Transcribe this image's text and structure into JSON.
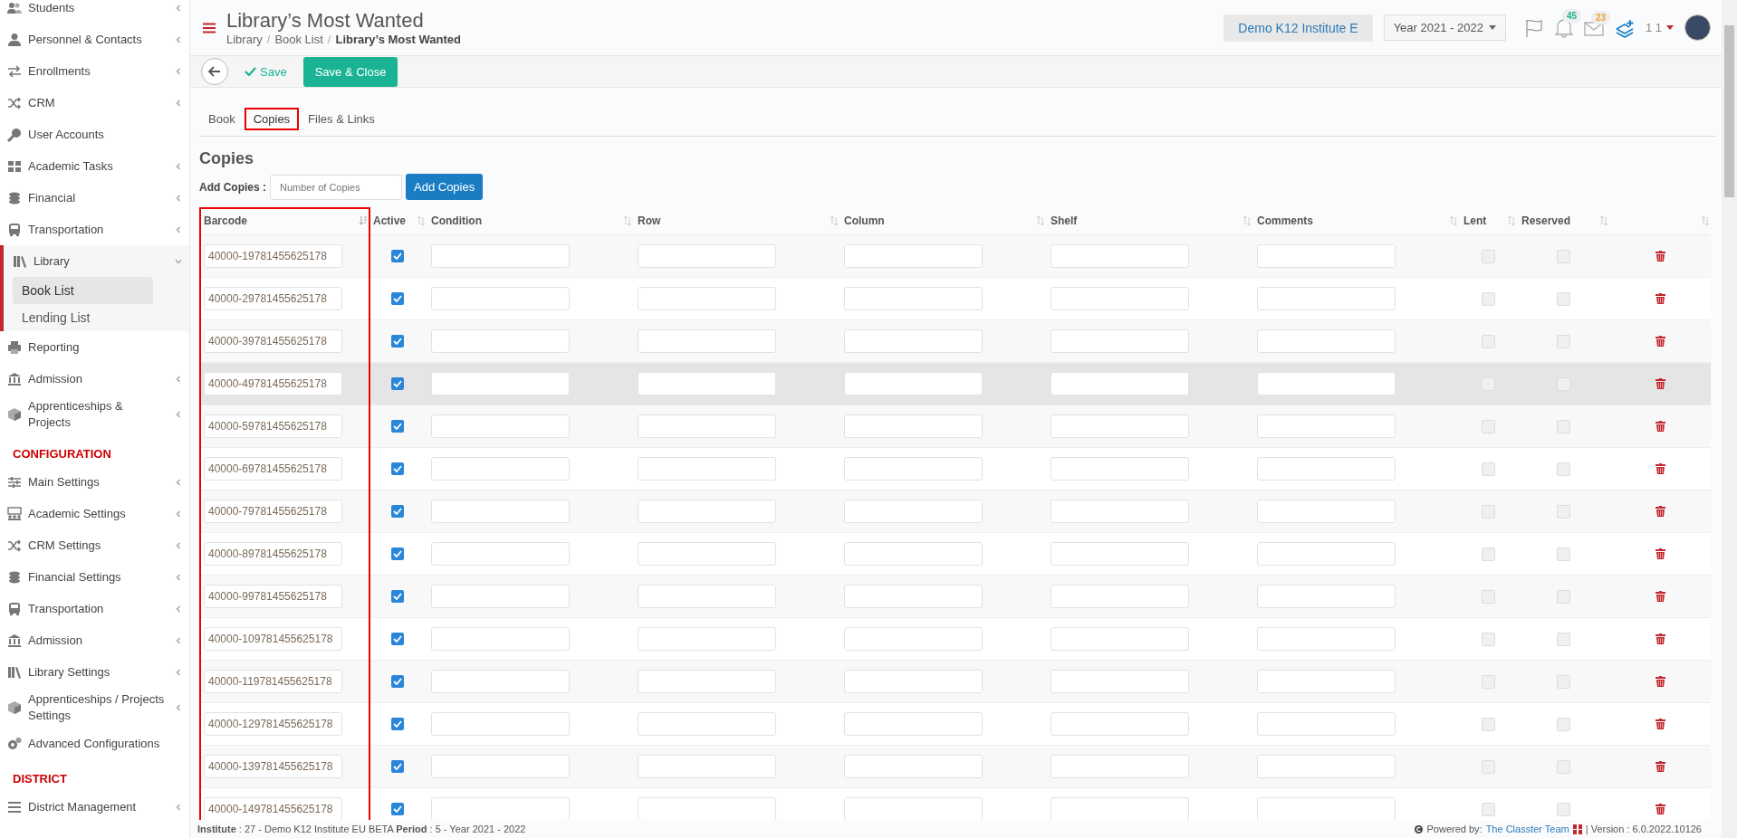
{
  "sidebar": {
    "groups": [
      {
        "items": [
          {
            "label": "Students",
            "has_submenu": true,
            "expanded": false
          },
          {
            "label": "Personnel & Contacts",
            "has_submenu": true,
            "expanded": false
          },
          {
            "label": "Enrollments",
            "has_submenu": true,
            "expanded": false
          },
          {
            "label": "CRM",
            "has_submenu": true,
            "expanded": false
          },
          {
            "label": "User Accounts",
            "has_submenu": false
          },
          {
            "label": "Academic Tasks",
            "has_submenu": true,
            "expanded": false
          },
          {
            "label": "Financial",
            "has_submenu": true,
            "expanded": false
          },
          {
            "label": "Transportation",
            "has_submenu": true,
            "expanded": false
          },
          {
            "label": "Library",
            "has_submenu": true,
            "expanded": true,
            "children": [
              {
                "label": "Book List",
                "selected": true
              },
              {
                "label": "Lending List",
                "selected": false
              }
            ]
          },
          {
            "label": "Reporting",
            "has_submenu": false
          },
          {
            "label": "Admission",
            "has_submenu": true,
            "expanded": false
          },
          {
            "label": "Apprenticeships & Projects",
            "has_submenu": true,
            "expanded": false
          }
        ]
      },
      {
        "heading": "CONFIGURATION",
        "items": [
          {
            "label": "Main Settings",
            "has_submenu": true,
            "expanded": false
          },
          {
            "label": "Academic Settings",
            "has_submenu": true,
            "expanded": false
          },
          {
            "label": "CRM Settings",
            "has_submenu": true,
            "expanded": false
          },
          {
            "label": "Financial Settings",
            "has_submenu": true,
            "expanded": false
          },
          {
            "label": "Transportation",
            "has_submenu": true,
            "expanded": false
          },
          {
            "label": "Admission",
            "has_submenu": true,
            "expanded": false
          },
          {
            "label": "Library Settings",
            "has_submenu": true,
            "expanded": false
          },
          {
            "label": "Apprenticeships / Projects Settings",
            "has_submenu": true,
            "expanded": false
          },
          {
            "label": "Advanced Configurations",
            "has_submenu": false
          }
        ]
      },
      {
        "heading": "DISTRICT",
        "items": [
          {
            "label": "District Management",
            "has_submenu": true,
            "expanded": false
          }
        ]
      }
    ]
  },
  "header": {
    "title": "Library’s Most Wanted",
    "breadcrumbs": [
      "Library",
      "Book List",
      "Library’s Most Wanted"
    ],
    "separator": "/",
    "institute": "Demo K12 Institute E",
    "year": "Year 2021 - 2022",
    "notifications": "45",
    "messages": "23",
    "user": "1 1"
  },
  "toolbar": {
    "save": "Save",
    "save_close": "Save & Close"
  },
  "tabs": [
    {
      "label": "Book",
      "selected": false
    },
    {
      "label": "Copies",
      "selected": true
    },
    {
      "label": "Files & Links",
      "selected": false
    }
  ],
  "copies": {
    "title": "Copies",
    "add_label": "Add Copies :",
    "placeholder": "Number of Copies",
    "add_button": "Add Copies"
  },
  "table": {
    "columns": [
      {
        "label": "Barcode",
        "sorted": true
      },
      {
        "label": "Active",
        "sorted": false
      },
      {
        "label": "Condition",
        "sorted": false
      },
      {
        "label": "Row",
        "sorted": false
      },
      {
        "label": "Column",
        "sorted": false
      },
      {
        "label": "Shelf",
        "sorted": false
      },
      {
        "label": "Comments",
        "sorted": false
      },
      {
        "label": "Lent",
        "sorted": false
      },
      {
        "label": "Reserved",
        "sorted": false
      },
      {
        "sorted": false
      }
    ],
    "rows": [
      {
        "barcode": "40000-19781455625178",
        "active": true,
        "lent": false,
        "reserved": false,
        "highlighted": false
      },
      {
        "barcode": "40000-29781455625178",
        "active": true,
        "lent": false,
        "reserved": false,
        "highlighted": false
      },
      {
        "barcode": "40000-39781455625178",
        "active": true,
        "lent": false,
        "reserved": false,
        "highlighted": false
      },
      {
        "barcode": "40000-49781455625178",
        "active": true,
        "lent": false,
        "reserved": false,
        "highlighted": true
      },
      {
        "barcode": "40000-59781455625178",
        "active": true,
        "lent": false,
        "reserved": false,
        "highlighted": false
      },
      {
        "barcode": "40000-69781455625178",
        "active": true,
        "lent": false,
        "reserved": false,
        "highlighted": false
      },
      {
        "barcode": "40000-79781455625178",
        "active": true,
        "lent": false,
        "reserved": false,
        "highlighted": false
      },
      {
        "barcode": "40000-89781455625178",
        "active": true,
        "lent": false,
        "reserved": false,
        "highlighted": false
      },
      {
        "barcode": "40000-99781455625178",
        "active": true,
        "lent": false,
        "reserved": false,
        "highlighted": false
      },
      {
        "barcode": "40000-109781455625178",
        "active": true,
        "lent": false,
        "reserved": false,
        "highlighted": false
      },
      {
        "barcode": "40000-119781455625178",
        "active": true,
        "lent": false,
        "reserved": false,
        "highlighted": false
      },
      {
        "barcode": "40000-129781455625178",
        "active": true,
        "lent": false,
        "reserved": false,
        "highlighted": false
      },
      {
        "barcode": "40000-139781455625178",
        "active": true,
        "lent": false,
        "reserved": false,
        "highlighted": false
      },
      {
        "barcode": "40000-149781455625178",
        "active": true,
        "lent": false,
        "reserved": false,
        "highlighted": false
      }
    ]
  },
  "footer": {
    "info": "**Institute** : 27 - Demo K12 Institute EU BETA **Period** : 5 - Year 2021 - 2022",
    "powered": "Powered by:",
    "link": "The Classter Team",
    "version": "| Version : 6.0.2022.10126"
  }
}
